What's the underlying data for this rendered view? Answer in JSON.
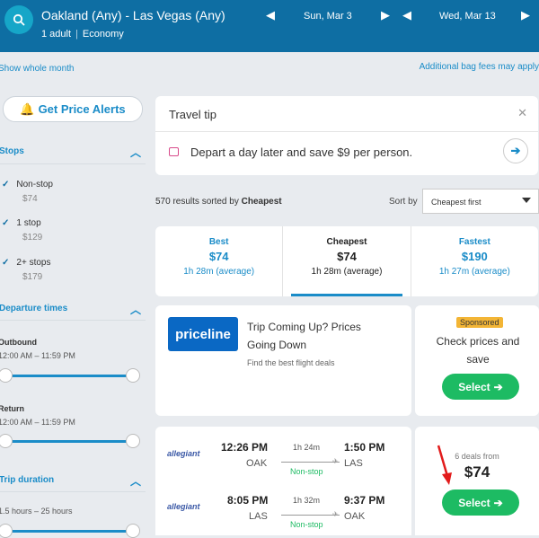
{
  "header": {
    "route": "Oakland (Any) - Las Vegas (Any)",
    "passengers": "1 adult",
    "cabin": "Economy",
    "depart_date": "Sun, Mar 3",
    "return_date": "Wed, Mar 13"
  },
  "subbar": {
    "left_link": "Show whole month",
    "right_link": "Additional bag fees may apply"
  },
  "sidebar": {
    "alerts_label": "Get Price Alerts",
    "stops": {
      "title": "Stops",
      "items": [
        {
          "label": "Non-stop",
          "price": "$74"
        },
        {
          "label": "1 stop",
          "price": "$129"
        },
        {
          "label": "2+ stops",
          "price": "$179"
        }
      ]
    },
    "departure": {
      "title": "Departure times",
      "outbound_label": "Outbound",
      "outbound_range": "12:00 AM – 11:59 PM",
      "return_label": "Return",
      "return_range": "12:00 AM – 11:59 PM"
    },
    "duration": {
      "title": "Trip duration",
      "range": "1.5 hours – 25 hours"
    }
  },
  "tip": {
    "title": "Travel tip",
    "message": "Depart a day later and save $9 per person."
  },
  "results": {
    "count_text": "570 results sorted by",
    "sorted_by": "Cheapest",
    "sort_label": "Sort by",
    "sort_value": "Cheapest first"
  },
  "tabs": [
    {
      "title": "Best",
      "price": "$74",
      "duration": "1h 28m (average)"
    },
    {
      "title": "Cheapest",
      "price": "$74",
      "duration": "1h 28m (average)"
    },
    {
      "title": "Fastest",
      "price": "$190",
      "duration": "1h 27m (average)"
    }
  ],
  "ad": {
    "logo": "priceline",
    "headline": "Trip Coming Up? Prices Going Down",
    "sub": "Find the best flight deals",
    "sponsored": "Sponsored",
    "cta_text": "Check prices and save",
    "button": "Select"
  },
  "flight": {
    "airline": "allegiant",
    "legs": [
      {
        "dep_time": "12:26 PM",
        "dep_code": "OAK",
        "duration": "1h 24m",
        "stops": "Non-stop",
        "arr_time": "1:50 PM",
        "arr_code": "LAS"
      },
      {
        "dep_time": "8:05 PM",
        "dep_code": "LAS",
        "duration": "1h 32m",
        "stops": "Non-stop",
        "arr_time": "9:37 PM",
        "arr_code": "OAK"
      }
    ],
    "deals": "6 deals from",
    "price": "$74",
    "button": "Select"
  }
}
